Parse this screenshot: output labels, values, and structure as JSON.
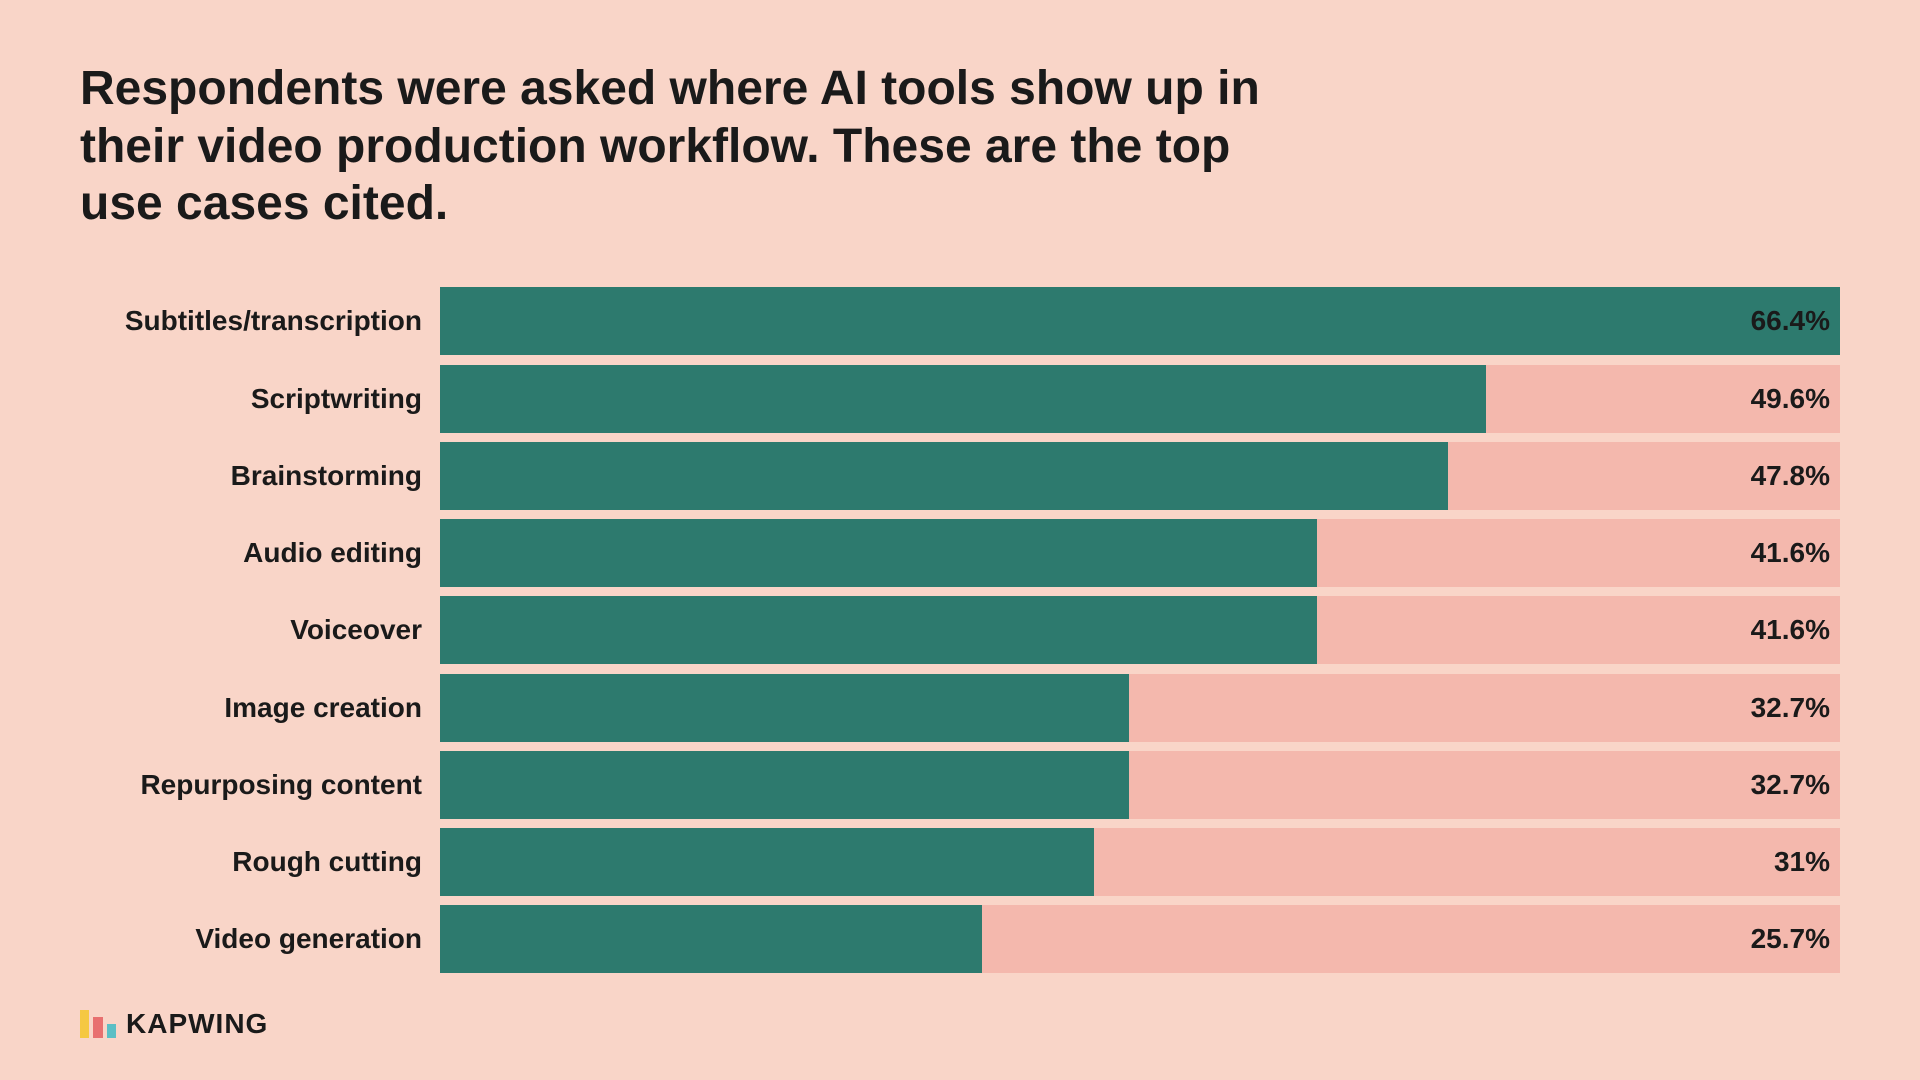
{
  "title": "Respondents were asked where AI tools show up in their video production workflow. These are the top use cases cited.",
  "chart": {
    "bars": [
      {
        "label": "Subtitles/transcription",
        "value": "66.4%",
        "pct": 66.4
      },
      {
        "label": "Scriptwriting",
        "value": "49.6%",
        "pct": 49.6
      },
      {
        "label": "Brainstorming",
        "value": "47.8%",
        "pct": 47.8
      },
      {
        "label": "Audio editing",
        "value": "41.6%",
        "pct": 41.6
      },
      {
        "label": "Voiceover",
        "value": "41.6%",
        "pct": 41.6
      },
      {
        "label": "Image creation",
        "value": "32.7%",
        "pct": 32.7
      },
      {
        "label": "Repurposing content",
        "value": "32.7%",
        "pct": 32.7
      },
      {
        "label": "Rough cutting",
        "value": "31%",
        "pct": 31.0
      },
      {
        "label": "Video generation",
        "value": "25.7%",
        "pct": 25.7
      }
    ],
    "max_pct": 66.4
  },
  "logo": {
    "text": "KAPWING"
  }
}
